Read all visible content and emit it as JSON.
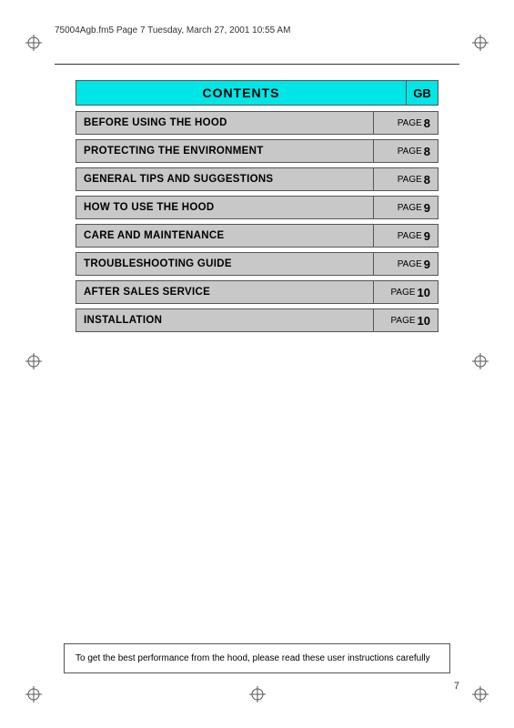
{
  "header": {
    "file_info": "75004Agb.fm5  Page 7  Tuesday, March 27, 2001  10:55 AM"
  },
  "contents": {
    "title": "CONTENTS",
    "gb_label": "GB",
    "rows": [
      {
        "label": "BEFORE USING THE HOOD",
        "page_word": "PAGE",
        "page_num": "8"
      },
      {
        "label": "PROTECTING THE ENVIRONMENT",
        "page_word": "PAGE",
        "page_num": "8"
      },
      {
        "label": "GENERAL TIPS AND SUGGESTIONS",
        "page_word": "PAGE",
        "page_num": "8"
      },
      {
        "label": "HOW TO USE THE HOOD",
        "page_word": "PAGE",
        "page_num": "9"
      },
      {
        "label": "CARE AND MAINTENANCE",
        "page_word": "PAGE",
        "page_num": "9"
      },
      {
        "label": "TROUBLESHOOTING GUIDE",
        "page_word": "PAGE",
        "page_num": "9"
      },
      {
        "label": "AFTER SALES SERVICE",
        "page_word": "PAGE",
        "page_num": "10"
      },
      {
        "label": "INSTALLATION",
        "page_word": "PAGE",
        "page_num": "10"
      }
    ]
  },
  "footer": {
    "note": "To get the best performance from the hood, please read these user instructions carefully",
    "page_number": "7"
  }
}
